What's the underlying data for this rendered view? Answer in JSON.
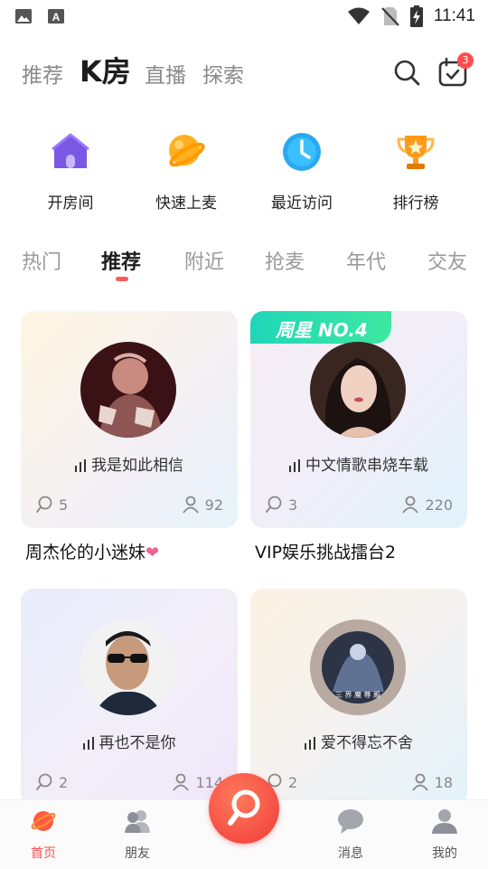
{
  "status_bar": {
    "time": "11:41",
    "icons": [
      "image-icon",
      "text-a-icon",
      "wifi-icon",
      "no-sim-icon",
      "battery-charging-icon"
    ]
  },
  "top_nav": {
    "tabs": [
      "推荐",
      "K房",
      "直播",
      "探索"
    ],
    "active_tab": "K房",
    "calendar_badge": "3"
  },
  "quick_actions": [
    {
      "label": "开房间",
      "icon": "house-icon"
    },
    {
      "label": "快速上麦",
      "icon": "planet-icon"
    },
    {
      "label": "最近访问",
      "icon": "clock-icon"
    },
    {
      "label": "排行榜",
      "icon": "trophy-icon"
    }
  ],
  "category_tabs": [
    "热门",
    "推荐",
    "附近",
    "抢麦",
    "年代",
    "交友"
  ],
  "active_category": "推荐",
  "rooms": [
    {
      "song": "我是如此相信",
      "comments": "5",
      "listeners": "92",
      "title": "周杰伦的小迷妹",
      "has_heart": true
    },
    {
      "song": "中文情歌串烧车载",
      "comments": "3",
      "listeners": "220",
      "title": "VIP娱乐挑战擂台2",
      "tag": "周星 NO.4"
    },
    {
      "song": "再也不是你",
      "comments": "2",
      "listeners": "114",
      "title": ""
    },
    {
      "song": "爱不得忘不舍",
      "comments": "2",
      "listeners": "18",
      "title": ""
    }
  ],
  "colors": {
    "accent": "#ff4d4f",
    "tab_active": "#1d1d1d",
    "tab_inactive": "#8a8a8a"
  },
  "bottom_nav": [
    {
      "label": "首页",
      "icon": "planet-icon",
      "active": true
    },
    {
      "label": "朋友",
      "icon": "friends-icon",
      "active": false
    },
    {
      "label": "",
      "icon": "mic-center-icon",
      "active": false
    },
    {
      "label": "消息",
      "icon": "chat-bubble-icon",
      "active": false
    },
    {
      "label": "我的",
      "icon": "profile-icon",
      "active": false
    }
  ]
}
